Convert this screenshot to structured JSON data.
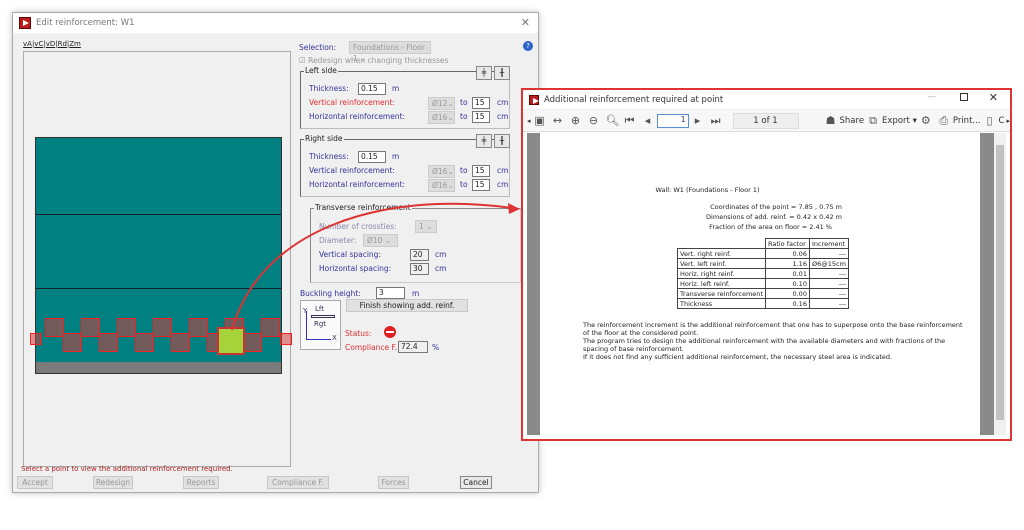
{
  "dialog": {
    "title": "Edit reinforcement: W1",
    "view_tabs": [
      "vA",
      "vC",
      "vD",
      "Rd",
      "Zm"
    ],
    "selection_label": "Selection:",
    "selection_value": "Foundations - Floor 1",
    "redesign_label": "Redesign when changing thicknesses",
    "left_side": {
      "title": "Left side",
      "thickness_label": "Thickness:",
      "thickness": "0.15",
      "unit_m": "m",
      "vert_label": "Vertical reinforcement:",
      "vert_dia": "Ø12",
      "vert_spacing": "15",
      "horiz_label": "Horizontal reinforcement:",
      "horiz_dia": "Ø16",
      "horiz_spacing": "15",
      "to": "to",
      "cm": "cm"
    },
    "right_side": {
      "title": "Right side",
      "thickness_label": "Thickness:",
      "thickness": "0.15",
      "unit_m": "m",
      "vert_label": "Vertical reinforcement:",
      "vert_dia": "Ø16",
      "vert_spacing": "15",
      "horiz_label": "Horizontal reinforcement:",
      "horiz_dia": "Ø16",
      "horiz_spacing": "15",
      "to": "to",
      "cm": "cm"
    },
    "transverse": {
      "title": "Transverse reinforcement",
      "crossties_label": "Number of crossties:",
      "crossties": "1",
      "diameter_label": "Diameter:",
      "diameter": "Ø10",
      "vspacing_label": "Vertical spacing:",
      "vspacing": "20",
      "hspacing_label": "Horizontal spacing:",
      "hspacing": "30",
      "cm": "cm"
    },
    "buckling_label": "Buckling height:",
    "buckling": "3",
    "buckling_unit": "m",
    "finish_button": "Finish showing add. reinf.",
    "axes": {
      "y": "Y",
      "x": "X",
      "lft": "Lft",
      "rgt": "Rgt"
    },
    "status_label": "Status:",
    "compliance_label": "Compliance F.:",
    "compliance": "72.4",
    "compliance_unit": "%",
    "hint": "Select a point to view the additional reinforcement required.",
    "buttons": [
      "Accept",
      "Redesign",
      "Reports",
      "Compliance F.",
      "Forces",
      "Cancel"
    ]
  },
  "report": {
    "title": "Additional reinforcement required at point",
    "page_input": "1",
    "page_count": "1 of 1",
    "share": "Share",
    "export": "Export",
    "print": "Print...",
    "close_partial": "C",
    "wall": "Wall: W1 (Foundations - Floor 1)",
    "coords": "Coordinates of the point  = 7.85 , 0.75 m",
    "dims": "Dimensions of add. reinf.  = 0.42 x 0.42 m",
    "fraction": "Fraction of the area on floor  = 2.41 %",
    "headers": [
      "Ratio factor",
      "Increment"
    ],
    "rows": [
      [
        "Vert. right reinf.",
        "0.06",
        "---"
      ],
      [
        "Vert. left reinf.",
        "1.16",
        "Ø6@15cm"
      ],
      [
        "Horiz. right reinf.",
        "0.01",
        "---"
      ],
      [
        "Horiz. left reinf.",
        "0.10",
        "---"
      ],
      [
        "Transverse reinforcement",
        "0.00",
        "---"
      ],
      [
        "Thickness",
        "0.16",
        "---"
      ]
    ],
    "notes": [
      "The reinforcement increment is the additional reinforcement that one has to superpose onto the base reinforcement of the floor at the considered point.",
      "The program tries to design the additional reinforcement with the available diameters and with fractions of the spacing of base reinforcement.",
      "If it does not find any sufficient additional reinforcement, the necessary steel area is indicated."
    ]
  },
  "colors": {
    "wall": "#008080",
    "accent_red": "#d33333",
    "highlight": "#a6d23a"
  }
}
